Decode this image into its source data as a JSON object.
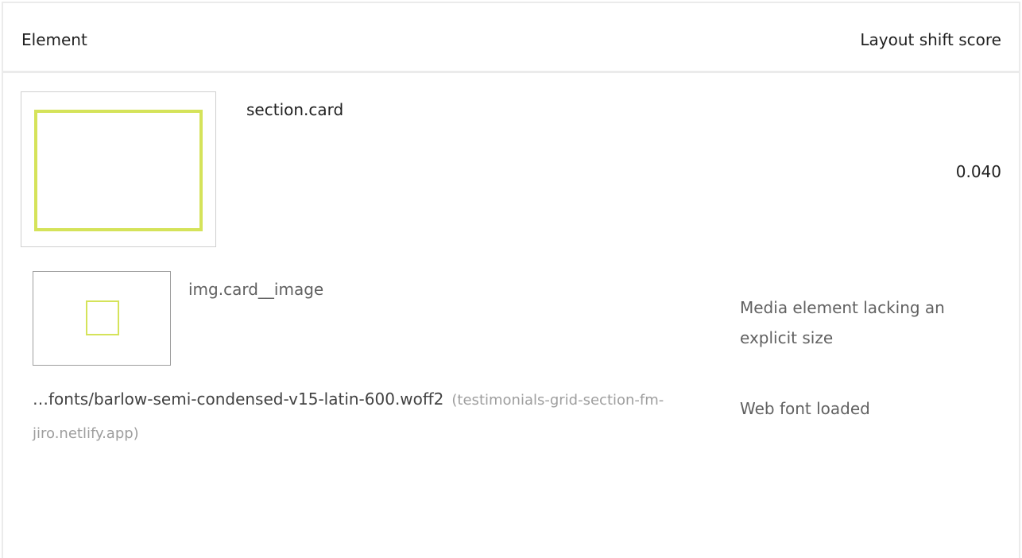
{
  "table": {
    "header": {
      "element_label": "Element",
      "score_label": "Layout shift score"
    },
    "row": {
      "element": "section.card",
      "score": "0.040",
      "thumbnail_highlight_color": "#d5e35a",
      "causes": [
        {
          "element": "img.card__image",
          "reason": "Media element lacking an explicit size"
        },
        {
          "url": "…fonts/barlow-semi-condensed-v15-latin-600.woff2",
          "origin": "(testimonials-grid-section-fm-jiro.netlify.app)",
          "reason": "Web font loaded"
        }
      ]
    }
  }
}
